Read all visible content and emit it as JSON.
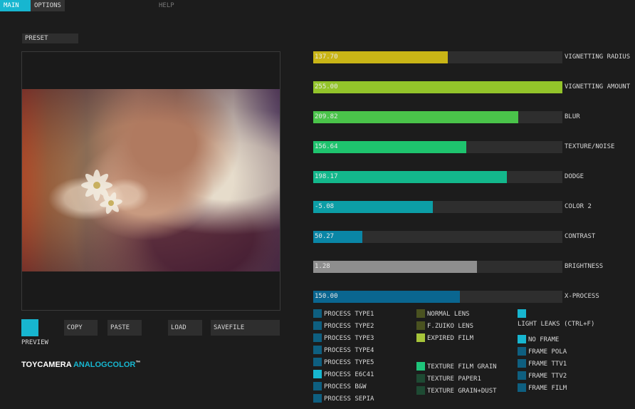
{
  "tabs": {
    "main": "MAIN",
    "options": "OPTIONS",
    "help": "HELP"
  },
  "preset": {
    "label": "PRESET"
  },
  "buttons": {
    "preview": "PREVIEW",
    "copy": "COPY",
    "paste": "PASTE",
    "load": "LOAD",
    "savefile": "SAVEFILE"
  },
  "brand": {
    "part1": "TOYCAMERA",
    "part2": "ANALOGCOLOR",
    "tm": "™"
  },
  "sliders": [
    {
      "label": "VIGNETTING RADIUS",
      "value": "137.70",
      "fill": 0.54,
      "color": "#c9b516"
    },
    {
      "label": "VIGNETTING AMOUNT",
      "value": "255.00",
      "fill": 1.0,
      "color": "#93c42a"
    },
    {
      "label": "BLUR",
      "value": "209.82",
      "fill": 0.823,
      "color": "#4ac44a"
    },
    {
      "label": "TEXTURE/NOISE",
      "value": "156.64",
      "fill": 0.614,
      "color": "#1ec46e"
    },
    {
      "label": "DODGE",
      "value": "198.17",
      "fill": 0.777,
      "color": "#13b88c"
    },
    {
      "label": "COLOR 2",
      "value": "-5.08",
      "fill": 0.48,
      "color": "#0c9ea6"
    },
    {
      "label": "CONTRAST",
      "value": "50.27",
      "fill": 0.197,
      "color": "#0a86a6"
    },
    {
      "label": "BRIGHTNESS",
      "value": "1.28",
      "fill": 0.657,
      "color": "#8e8e8e"
    },
    {
      "label": "X-PROCESS",
      "value": "150.00",
      "fill": 0.588,
      "color": "#0a6690"
    }
  ],
  "process_options": [
    {
      "label": "PROCESS TYPE1",
      "color": "#0e5f80"
    },
    {
      "label": "PROCESS TYPE2",
      "color": "#0e5f80"
    },
    {
      "label": "PROCESS TYPE3",
      "color": "#0e5f80"
    },
    {
      "label": "PROCESS TYPE4",
      "color": "#0e5f80"
    },
    {
      "label": "PROCESS TYPE5",
      "color": "#0e5f80"
    },
    {
      "label": "PROCESS E6C41",
      "color": "#17b6d0"
    },
    {
      "label": "PROCESS B&W",
      "color": "#0e5f80"
    },
    {
      "label": "PROCESS SEPIA",
      "color": "#0e5f80"
    }
  ],
  "lens_options": [
    {
      "label": "NORMAL LENS",
      "color": "#4a5220"
    },
    {
      "label": "F.ZUIKO LENS",
      "color": "#4a5220"
    },
    {
      "label": "EXPIRED FILM",
      "color": "#a6c43a"
    }
  ],
  "texture_options": [
    {
      "label": "TEXTURE FILM GRAIN",
      "color": "#1ec47a"
    },
    {
      "label": "TEXTURE PAPER1",
      "color": "#1e4a33"
    },
    {
      "label": "TEXTURE GRAIN+DUST",
      "color": "#1e4a33"
    }
  ],
  "light_leaks": {
    "label": "LIGHT LEAKS (CTRL+F)",
    "color": "#17b6d0"
  },
  "frame_options": [
    {
      "label": "NO FRAME",
      "color": "#17b6d0"
    },
    {
      "label": "FRAME POLA",
      "color": "#0e5f80"
    },
    {
      "label": "FRAME TTV1",
      "color": "#0e5f80"
    },
    {
      "label": "FRAME TTV2",
      "color": "#0e5f80"
    },
    {
      "label": "FRAME FILM",
      "color": "#0e5f80"
    }
  ],
  "colors": {
    "accent": "#17b6d0",
    "panel": "#2e2e2e",
    "background": "#1c1c1c"
  }
}
